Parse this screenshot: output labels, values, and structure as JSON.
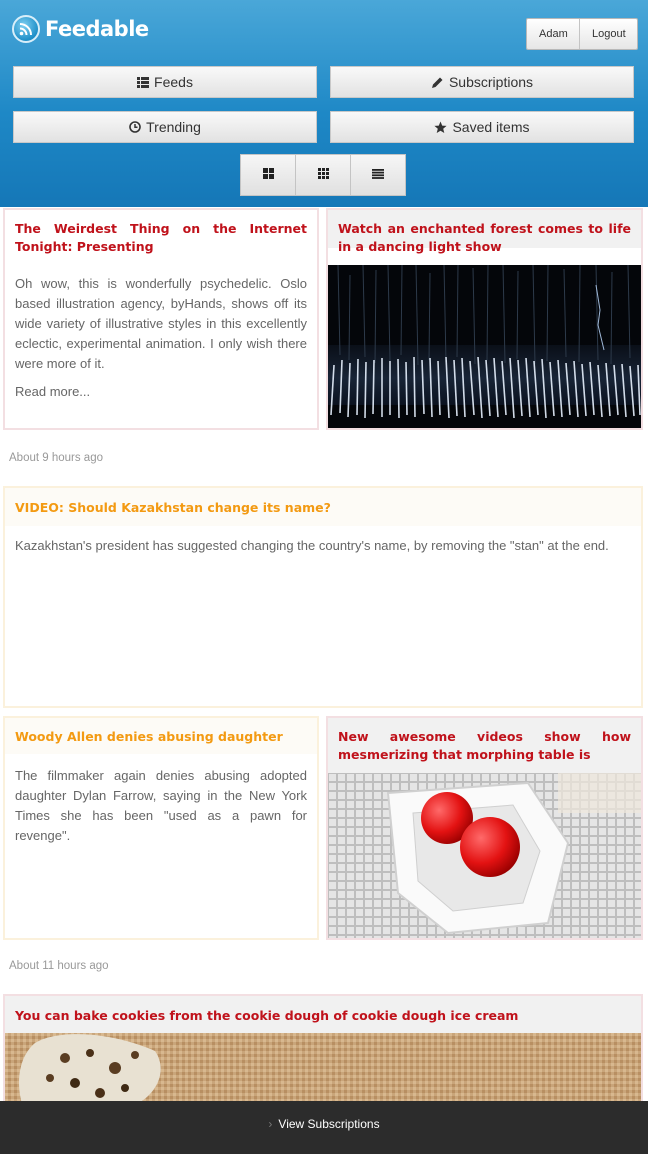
{
  "app": {
    "name": "Feedable"
  },
  "user_menu": {
    "user_label": "Adam",
    "logout_label": "Logout"
  },
  "nav": {
    "feeds": "Feeds",
    "subscriptions": "Subscriptions",
    "trending": "Trending",
    "saved": "Saved items"
  },
  "view_toggle": [
    "grid-large-icon",
    "grid-small-icon",
    "list-icon"
  ],
  "colors": {
    "header": "#1e88c6",
    "title_unread": "#c0121b",
    "title_read": "#f39a12",
    "bottom_bar": "#2c2c2c"
  },
  "groups": [
    {
      "items": [
        {
          "title": "The Weirdest Thing on the Internet Tonight: Presenting",
          "excerpt": "Oh wow, this is wonderfully psychedelic. Oslo based illustration agency, byHands, shows off its wide variety of illustrative styles in this excellently eclectic, experimental animation. I only wish there were more of it.",
          "read_more": "Read more..."
        },
        {
          "title": "Watch an enchanted forest comes to life in a dancing light show"
        }
      ],
      "timestamp": "About 9 hours ago"
    },
    {
      "items": [
        {
          "title": "VIDEO: Should Kazakhstan change its name?",
          "excerpt": "Kazakhstan's president has suggested changing the country's name, by removing the \"stan\" at the end."
        },
        {
          "title": "Woody Allen denies abusing daughter",
          "excerpt": "The filmmaker again denies abusing adopted daughter Dylan Farrow, saying in the New York Times she has been \"used as a pawn for revenge\"."
        },
        {
          "title": "New awesome videos show how mesmerizing that morphing table is"
        }
      ],
      "timestamp": "About 11 hours ago"
    },
    {
      "items": [
        {
          "title": "You can bake cookies from the cookie dough of cookie dough ice cream"
        }
      ]
    }
  ],
  "bottom_bar": {
    "label": "View Subscriptions"
  }
}
